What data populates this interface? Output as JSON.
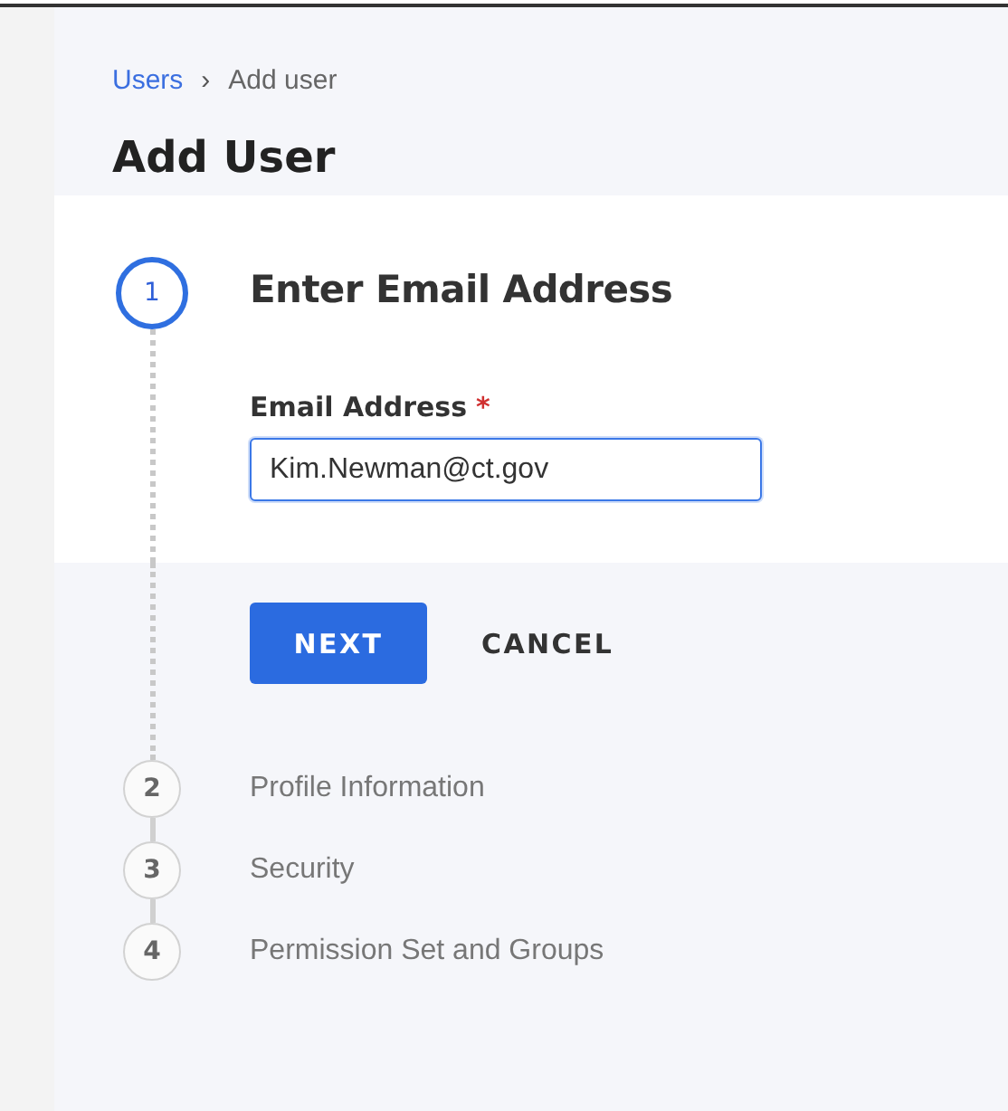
{
  "breadcrumb": [
    {
      "label": "Users",
      "kind": "link"
    },
    {
      "label": "Add user",
      "kind": "current"
    }
  ],
  "breadcrumb_separator": "›",
  "page_title": "Add User",
  "steps": [
    {
      "number": "1",
      "title": "Enter Email Address",
      "selected": true
    },
    {
      "number": "2",
      "title": "Profile Information",
      "selected": false
    },
    {
      "number": "3",
      "title": "Security",
      "selected": false
    },
    {
      "number": "4",
      "title": "Permission Set and Groups",
      "selected": false
    }
  ],
  "email_field": {
    "label": "Email Address",
    "required_mark": "*",
    "value": "Kim.Newman@ct.gov",
    "focused": true
  },
  "buttons": [
    {
      "label": "NEXT",
      "kind": "primary"
    },
    {
      "label": "CANCEL",
      "kind": "text"
    }
  ]
}
